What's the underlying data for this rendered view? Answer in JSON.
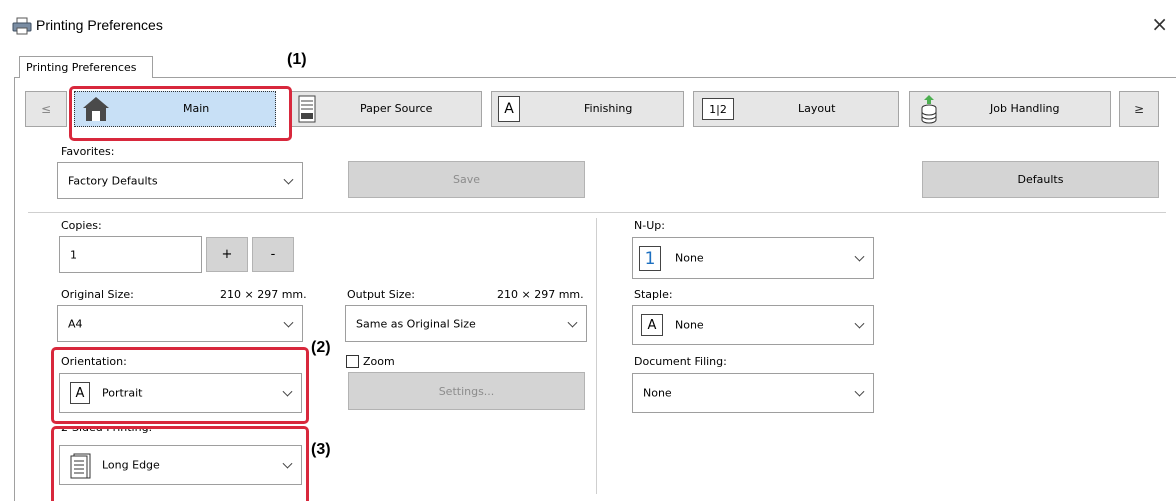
{
  "window": {
    "title": "Printing Preferences",
    "close_glyph": "×"
  },
  "tab": {
    "label": "Printing Preferences"
  },
  "nav": {
    "prev_glyph": "≤",
    "next_glyph": "≥",
    "items": [
      {
        "label": "Main",
        "icon": "home-icon",
        "selected": true
      },
      {
        "label": "Paper Source",
        "icon": "paper-tray-icon"
      },
      {
        "label": "Finishing",
        "icon": "finishing-icon"
      },
      {
        "label": "Layout",
        "icon": "layout-icon"
      },
      {
        "label": "Job Handling",
        "icon": "job-handling-icon"
      }
    ],
    "layout_icon_text": "1|2",
    "finishing_icon_text": "A"
  },
  "favorites": {
    "label": "Favorites:",
    "value": "Factory Defaults",
    "save_label": "Save",
    "defaults_label": "Defaults"
  },
  "copies": {
    "label": "Copies:",
    "value": "1",
    "plus": "+",
    "minus": "-"
  },
  "original_size": {
    "label": "Original Size:",
    "dims": "210 × 297 mm.",
    "value": "A4"
  },
  "output_size": {
    "label": "Output Size:",
    "dims": "210 × 297 mm.",
    "value": "Same as Original Size"
  },
  "zoom": {
    "label": "Zoom",
    "checked": false,
    "settings_label": "Settings..."
  },
  "orientation": {
    "label": "Orientation:",
    "value": "Portrait",
    "icon_text": "A"
  },
  "two_sided": {
    "label": "2-Sided Printing:",
    "value": "Long Edge"
  },
  "nup": {
    "label": "N-Up:",
    "value": "None",
    "icon_text": "1"
  },
  "staple": {
    "label": "Staple:",
    "value": "None",
    "icon_text": "A"
  },
  "document_filing": {
    "label": "Document Filing:",
    "value": "None"
  },
  "callouts": {
    "one": "(1)",
    "two": "(2)",
    "three": "(3)"
  },
  "colors": {
    "callout": "#d8283c",
    "nav_selected": "#c8e0f6",
    "nav_bg": "#e6e6e6",
    "nup_digit": "#1c6fc0"
  }
}
